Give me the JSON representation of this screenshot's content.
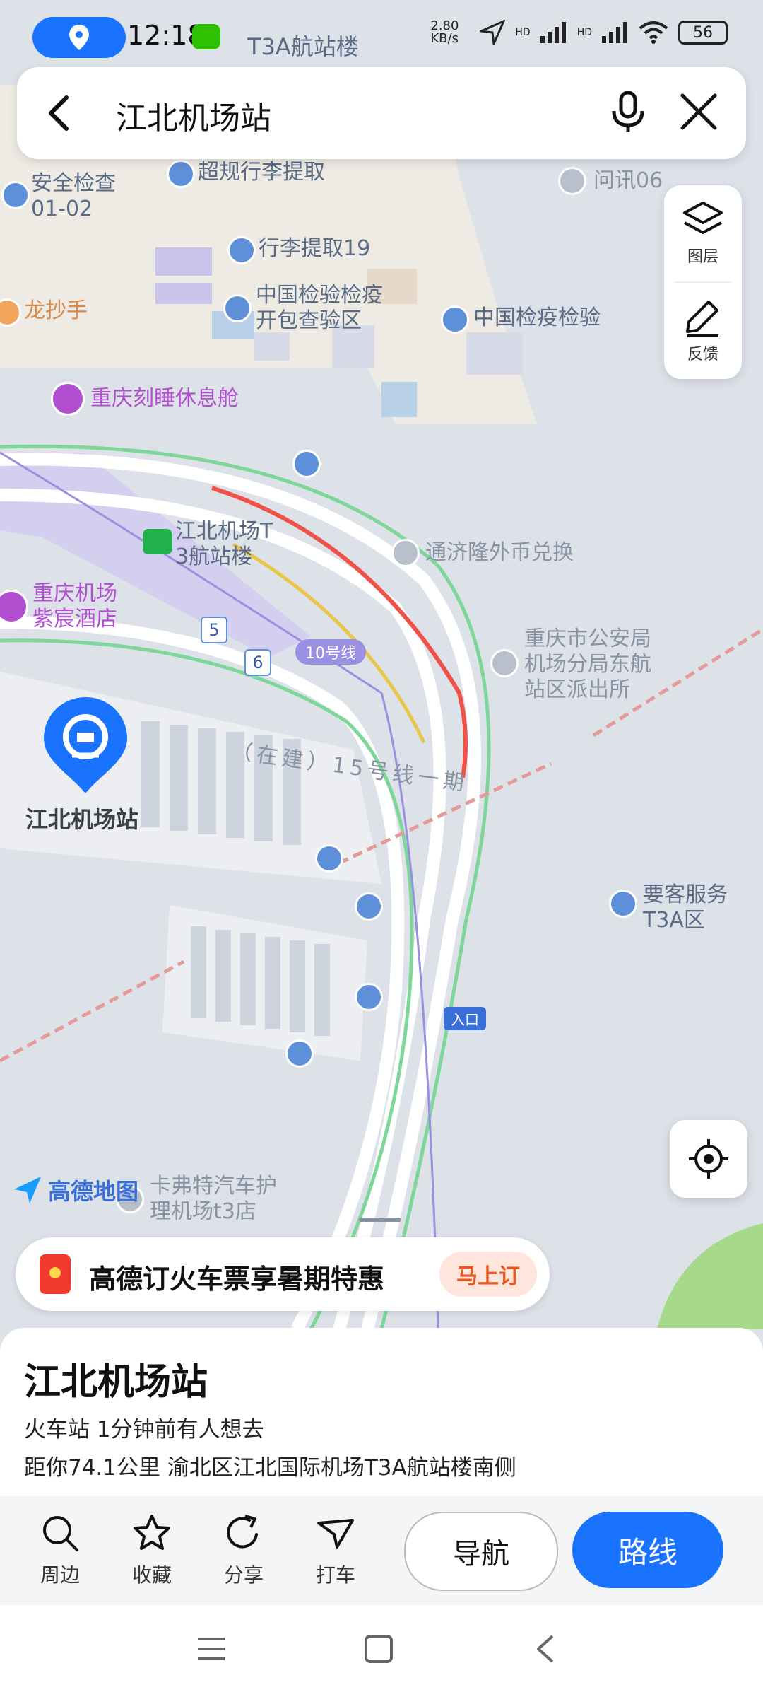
{
  "status_bar": {
    "time": "12:18",
    "net_speed": "2.80 KB/s",
    "battery": "56",
    "hd1": "HD",
    "hd2": "HD"
  },
  "search": {
    "query": "江北机场站"
  },
  "map_tools": {
    "layers_label": "图层",
    "feedback_label": "反馈"
  },
  "map_labels": {
    "top_label": "T3A航站楼",
    "security": "安全检查\n01-02",
    "oversize": "超规行李提取",
    "inquiry": "问讯06",
    "baggage19": "行李提取19",
    "quarantine_open": "中国检验检疫\n开包查验区",
    "quarantine": "中国检疫检验",
    "longchaoshou": "龙抄手",
    "capsule": "重庆刻睡休息舱",
    "t3_station": "江北机场T\n3航站楼",
    "exchange": "通济隆外币兑换",
    "hotel": "重庆机场\n紫宸酒店",
    "badge5": "5",
    "badge6": "6",
    "line10": "10号线",
    "police": "重庆市公安局\n机场分局东航\n站区派出所",
    "line15": "（在建）15号线一期",
    "station_name": "江北机场站",
    "vip": "要客服务\nT3A区",
    "entrance": "入口",
    "carwash": "卡弗特汽车护\n理机场t3店",
    "brand": "高德地图"
  },
  "promo": {
    "text": "高德订火车票享暑期特惠",
    "button": "马上订"
  },
  "place": {
    "title": "江北机场站",
    "category_line": "火车站  1分钟前有人想去",
    "address_line": "距你74.1公里  渝北区江北国际机场T3A航站楼南侧"
  },
  "actions": {
    "nearby": "周边",
    "favorite": "收藏",
    "share": "分享",
    "taxi": "打车",
    "navigate": "导航",
    "route": "路线"
  },
  "colors": {
    "accent": "#1a73ff",
    "promo_red": "#f23b2f",
    "traffic_green": "#7ed69a",
    "traffic_red": "#f0524a",
    "traffic_yellow": "#e8c64a"
  }
}
